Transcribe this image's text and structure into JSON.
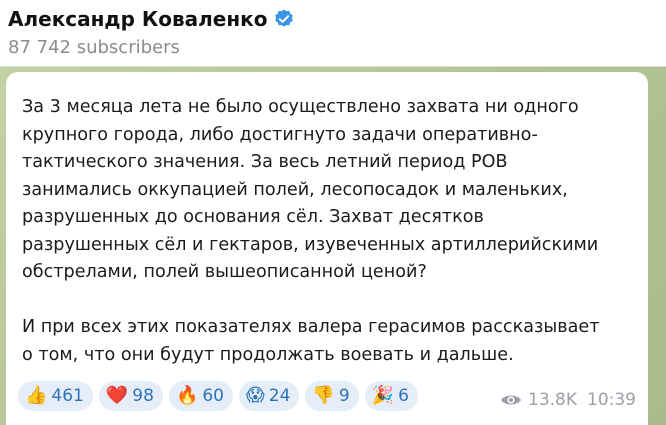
{
  "channel": {
    "name": "Александр Коваленко",
    "subscribers": "87 742 subscribers",
    "verified_icon": "verified-badge-icon",
    "accent_color": "#3a95e6"
  },
  "post": {
    "paragraph1_lines": [
      "За 3 месяца лета не было осуществлено захвата ни одного",
      "крупного города, либо достигнуто задачи оперативно-",
      "тактического значения. За весь летний период РОВ",
      "занимались оккупацией полей, лесопосадок и маленьких,",
      "разрушенных до основания сёл. Захват десятков",
      "разрушенных сёл и гектаров, изувеченных артиллерийскими",
      "обстрелами, полей вышеописанной ценой?"
    ],
    "paragraph2_lines": [
      "И при всех этих показателях валера герасимов рассказывает",
      "о том, что они будут продолжать воевать и дальше."
    ],
    "reactions": [
      {
        "emoji": "👍",
        "icon": "thumbs-up-icon",
        "count": "461"
      },
      {
        "emoji": "❤️",
        "icon": "heart-icon",
        "count": "98"
      },
      {
        "emoji": "🔥",
        "icon": "fire-icon",
        "count": "60"
      },
      {
        "emoji": "😱",
        "icon": "screaming-face-icon",
        "count": "24"
      },
      {
        "emoji": "👎",
        "icon": "thumbs-down-icon",
        "count": "9"
      },
      {
        "emoji": "🎉",
        "icon": "party-popper-icon",
        "count": "6"
      }
    ],
    "views": "13.8K",
    "time": "10:39"
  }
}
